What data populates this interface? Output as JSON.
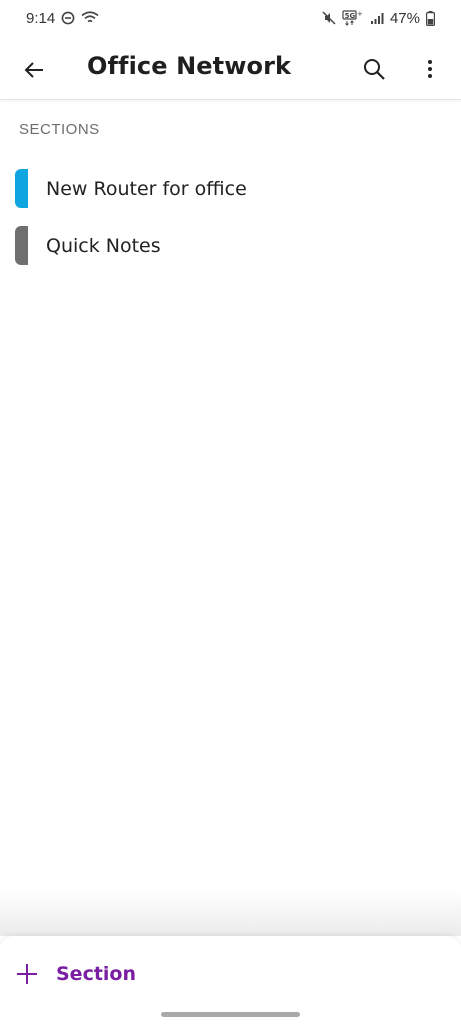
{
  "status_bar": {
    "time": "9:14",
    "battery": "47%",
    "icons": [
      "do-not-disturb-icon",
      "wifi-icon",
      "mute-icon",
      "5g-icon",
      "signal-icon",
      "battery-icon"
    ]
  },
  "app_bar": {
    "title": "Office Network",
    "icons": [
      "back-arrow-icon",
      "search-icon",
      "more-vert-icon"
    ]
  },
  "sections": {
    "header": "SECTIONS",
    "items": [
      {
        "label": "New Router for office",
        "color": "#0ea5e0"
      },
      {
        "label": "Quick Notes",
        "color": "#6f6f6f"
      }
    ]
  },
  "bottom_sheet": {
    "add_label": "Section",
    "accent": "#7a1fa2",
    "icon": "plus-icon"
  }
}
